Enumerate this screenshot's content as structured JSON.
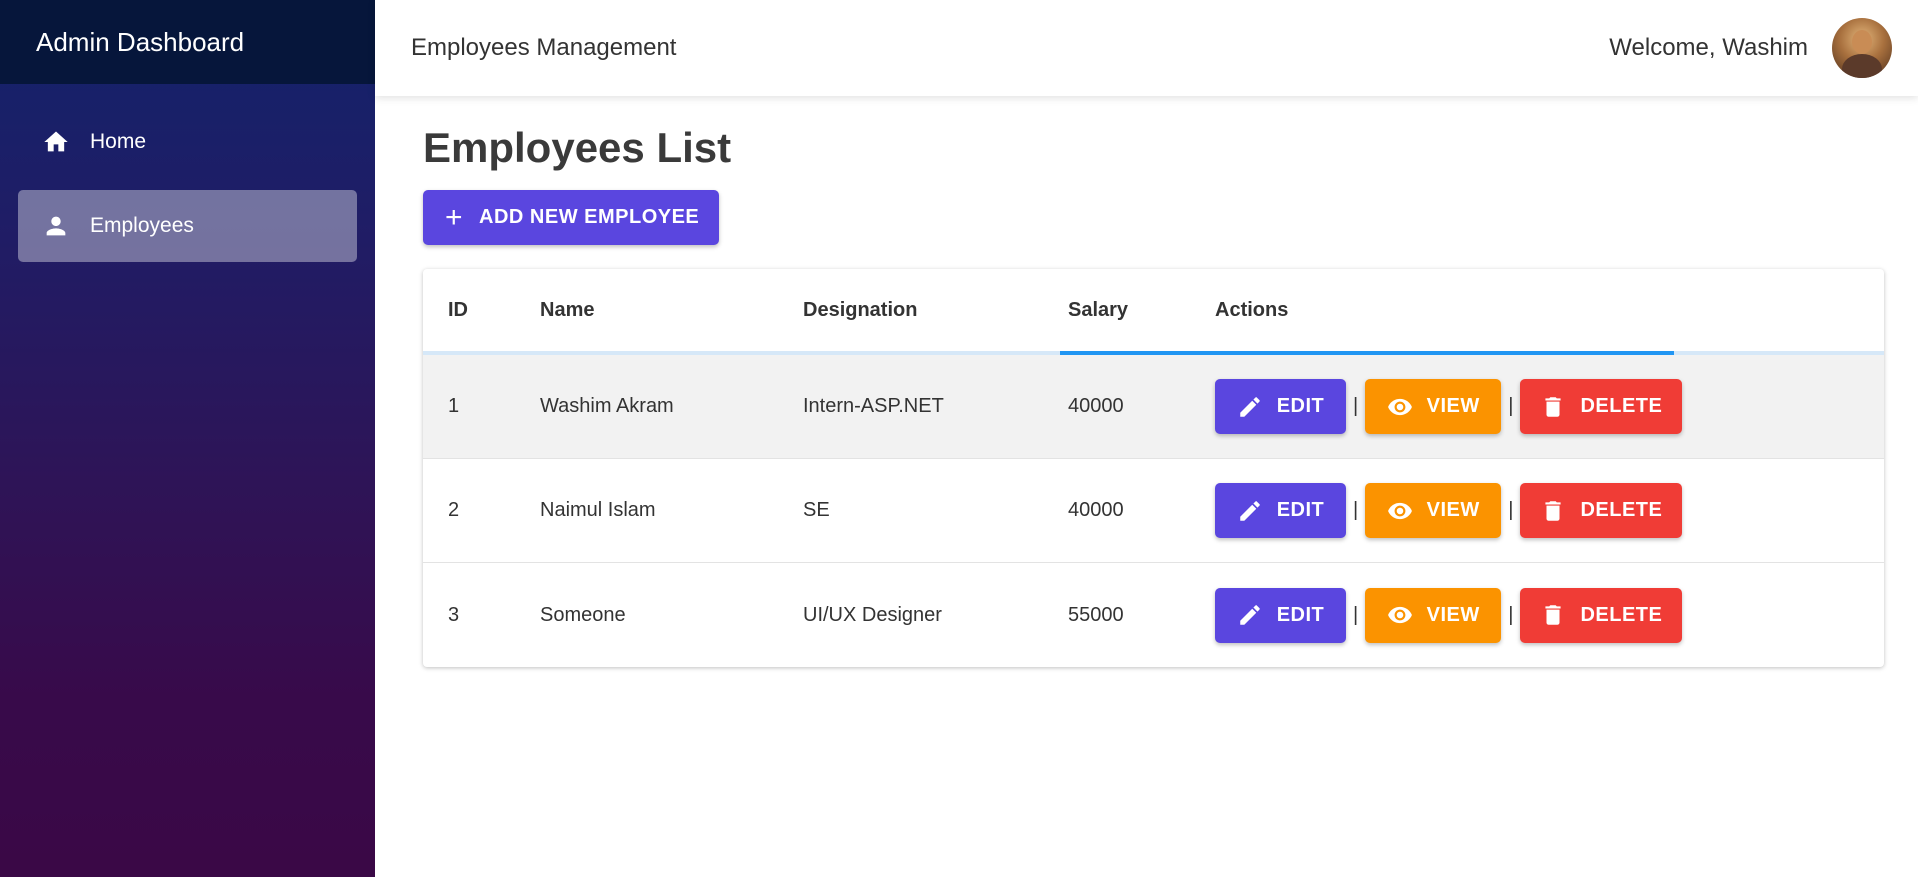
{
  "sidebar": {
    "title": "Admin Dashboard",
    "items": [
      {
        "label": "Home",
        "icon": "home-icon",
        "active": false
      },
      {
        "label": "Employees",
        "icon": "person-icon",
        "active": true
      }
    ]
  },
  "topbar": {
    "title": "Employees Management",
    "welcome": "Welcome, Washim",
    "avatar": "user-avatar"
  },
  "main": {
    "title": "Employees List",
    "add_button": "ADD NEW EMPLOYEE"
  },
  "table": {
    "columns": [
      "ID",
      "Name",
      "Designation",
      "Salary",
      "Actions"
    ],
    "rows": [
      {
        "id": "1",
        "name": "Washim Akram",
        "designation": "Intern-ASP.NET",
        "salary": "40000"
      },
      {
        "id": "2",
        "name": "Naimul Islam",
        "designation": "SE",
        "salary": "40000"
      },
      {
        "id": "3",
        "name": "Someone",
        "designation": "UI/UX Designer",
        "salary": "55000"
      }
    ],
    "actions": {
      "edit": "EDIT",
      "view": "VIEW",
      "delete": "DELETE",
      "separator": "|"
    }
  },
  "colors": {
    "primary": "#5a46df",
    "view": "#fb9300",
    "delete": "#f03c36",
    "progress": "#2196f3",
    "sidebar_header": "#06163b"
  }
}
